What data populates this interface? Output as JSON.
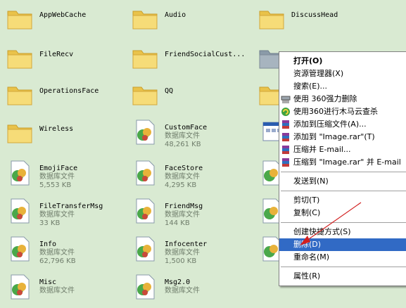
{
  "items": [
    {
      "kind": "folder",
      "name": "AppWebCache"
    },
    {
      "kind": "folder",
      "name": "Audio"
    },
    {
      "kind": "folder",
      "name": "DiscussHead"
    },
    {
      "kind": "folder",
      "name": "FileRecv"
    },
    {
      "kind": "folder",
      "name": "FriendSocialCust..."
    },
    {
      "kind": "folder",
      "name": "OperationsFace"
    },
    {
      "kind": "folder",
      "name": "QQ"
    },
    {
      "kind": "folder",
      "name": "Wireless"
    },
    {
      "kind": "db",
      "name": "CustomFace",
      "type": "数据库文件",
      "size": "48,261 KB"
    },
    {
      "kind": "db",
      "name": "EmojiFace",
      "type": "数据库文件",
      "size": "5,553 KB"
    },
    {
      "kind": "db",
      "name": "FaceStore",
      "type": "数据库文件",
      "size": "4,295 KB"
    },
    {
      "kind": "db",
      "name": "FileTransferMsg",
      "type": "数据库文件",
      "size": "33 KB"
    },
    {
      "kind": "db",
      "name": "FriendMsg",
      "type": "数据库文件",
      "size": "144 KB"
    },
    {
      "kind": "db",
      "name": "Info",
      "type": "数据库文件",
      "size": "62,796 KB"
    },
    {
      "kind": "db",
      "name": "Infocenter",
      "type": "数据库文件",
      "size": "1,500 KB"
    },
    {
      "kind": "db",
      "name": "Misc",
      "type": "数据库文件",
      "size": ""
    },
    {
      "kind": "db",
      "name": "Msg2.0",
      "type": "数据库文件",
      "size": ""
    }
  ],
  "context_menu": {
    "items": [
      {
        "label": "打开(O)",
        "bold": true,
        "icon": "none"
      },
      {
        "label": "资源管理器(X)",
        "icon": "none"
      },
      {
        "label": "搜索(E)...",
        "icon": "none"
      },
      {
        "label": "使用 360强力删除",
        "icon": "shredder-icon"
      },
      {
        "label": "使用360进行木马云查杀",
        "icon": "360-shield-icon"
      },
      {
        "label": "添加到压缩文件(A)...",
        "icon": "winrar-icon"
      },
      {
        "label": "添加到 \"Image.rar\"(T)",
        "icon": "winrar-icon"
      },
      {
        "label": "压缩并 E-mail...",
        "icon": "winrar-icon"
      },
      {
        "label": "压缩到 \"Image.rar\" 并 E-mail",
        "icon": "winrar-icon"
      },
      {
        "label": "发送到(N)",
        "icon": "none"
      },
      {
        "label": "剪切(T)",
        "icon": "none"
      },
      {
        "label": "复制(C)",
        "icon": "none"
      },
      {
        "label": "创建快捷方式(S)",
        "icon": "none"
      },
      {
        "label": "删除(D)",
        "icon": "none",
        "highlighted": true
      },
      {
        "label": "重命名(M)",
        "icon": "none"
      },
      {
        "label": "属性(R)",
        "icon": "none"
      }
    ]
  },
  "colors": {
    "background": "#d9ead2",
    "folder": "#f4d66a",
    "highlight": "#316ac5",
    "arrow": "#d21f1f"
  }
}
